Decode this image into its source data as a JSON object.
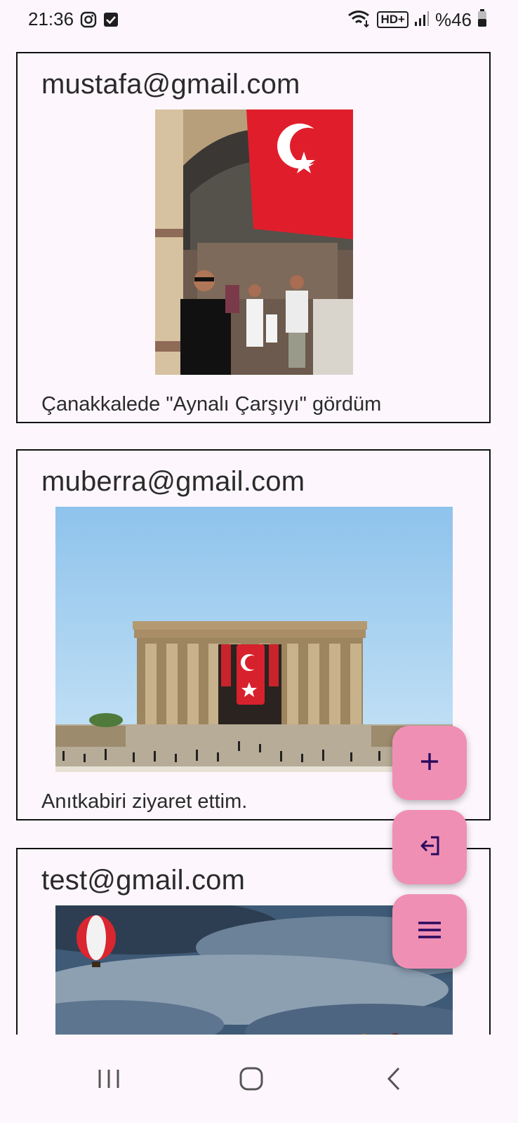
{
  "status_bar": {
    "time": "21:36",
    "left_icons": [
      "instagram-icon",
      "checkbox-icon"
    ],
    "right_icons": [
      "wifi-icon",
      "hd-plus-icon",
      "signal-icon",
      "battery-icon"
    ],
    "network_label": "HD+",
    "battery_text": "%46"
  },
  "posts": [
    {
      "email": "mustafa@gmail.com",
      "caption": "Çanakkalede \"Aynalı Çarşıyı\" gördüm",
      "image": "photo of a man under a Turkish flag in a bazaar arch"
    },
    {
      "email": "muberra@gmail.com",
      "caption": "Anıtkabiri ziyaret ettim.",
      "image": "photo of Anıtkabir with a Turkish flag"
    },
    {
      "email": "test@gmail.com",
      "caption": "",
      "image": "photo of hot air balloons in a cloudy sky"
    }
  ],
  "fabs": [
    {
      "name": "add-post-button",
      "icon": "plus-icon"
    },
    {
      "name": "logout-button",
      "icon": "logout-icon"
    },
    {
      "name": "menu-button",
      "icon": "menu-icon"
    }
  ],
  "colors": {
    "background": "#fdf7fd",
    "fab": "#f08fb4",
    "fab_icon": "#2a0a5e",
    "card_border": "#111111"
  },
  "nav_bar": {
    "icons": [
      "recent-apps-icon",
      "home-icon",
      "back-icon"
    ]
  }
}
